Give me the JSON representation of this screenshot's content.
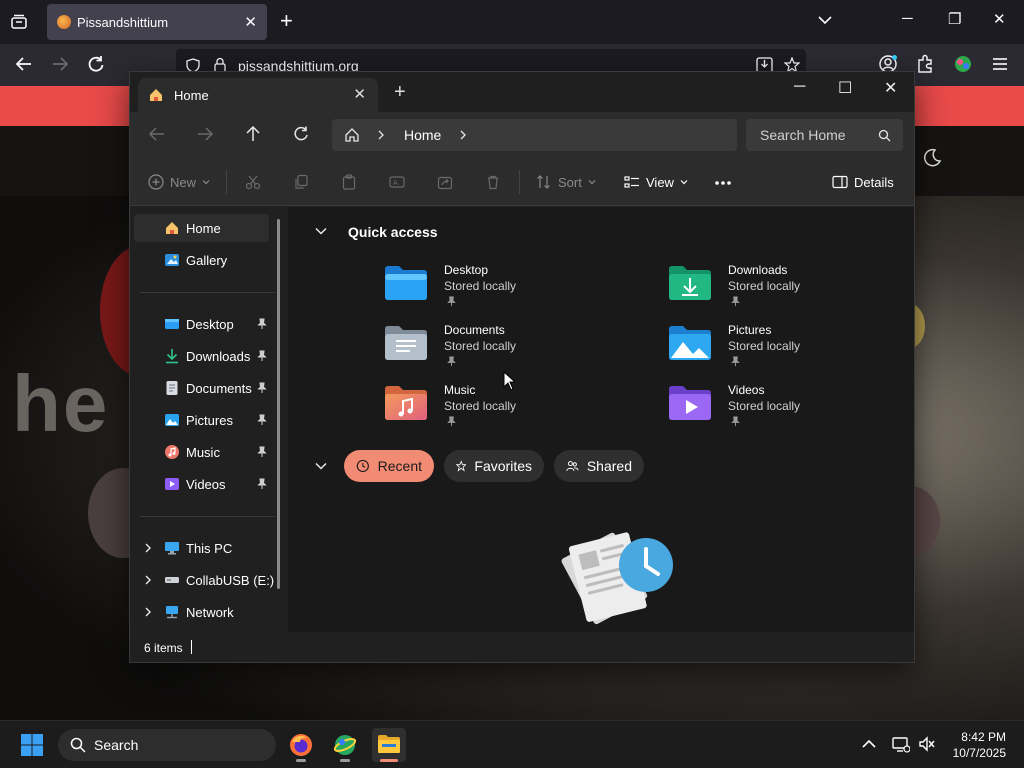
{
  "browser": {
    "tab_title": "Pissandshittium",
    "url": "pissandshittium.org",
    "page_bg_text": "he",
    "icons": [
      "tab-list-icon",
      "close-icon",
      "plus-icon",
      "chevron-down-icon",
      "minimize-icon",
      "maximize-icon",
      "close-icon",
      "back-icon",
      "forward-icon",
      "reload-icon",
      "shield-icon",
      "lock-icon",
      "download-icon",
      "star-icon",
      "account-icon",
      "extensions-icon",
      "menu-icon"
    ]
  },
  "explorer": {
    "tab_title": "Home",
    "breadcrumb": [
      "Home"
    ],
    "search_placeholder": "Search Home",
    "toolbar": {
      "new": "New",
      "sort": "Sort",
      "view": "View",
      "details": "Details"
    },
    "sidebar": {
      "top": [
        {
          "label": "Home",
          "icon": "home-icon",
          "selected": true
        },
        {
          "label": "Gallery",
          "icon": "gallery-icon"
        }
      ],
      "pinned": [
        {
          "label": "Desktop",
          "icon": "desktop-icon"
        },
        {
          "label": "Downloads",
          "icon": "downloads-icon"
        },
        {
          "label": "Documents",
          "icon": "documents-icon"
        },
        {
          "label": "Pictures",
          "icon": "pictures-icon"
        },
        {
          "label": "Music",
          "icon": "music-icon"
        },
        {
          "label": "Videos",
          "icon": "videos-icon"
        }
      ],
      "drives": [
        {
          "label": "This PC",
          "icon": "pc-icon"
        },
        {
          "label": "CollabUSB (E:)",
          "icon": "usb-drive-icon"
        },
        {
          "label": "Network",
          "icon": "network-icon"
        }
      ]
    },
    "quick_access": {
      "title": "Quick access",
      "items": [
        {
          "name": "Desktop",
          "status": "Stored locally",
          "icon": "desktop-folder-icon"
        },
        {
          "name": "Downloads",
          "status": "Stored locally",
          "icon": "downloads-folder-icon"
        },
        {
          "name": "Documents",
          "status": "Stored locally",
          "icon": "documents-folder-icon"
        },
        {
          "name": "Pictures",
          "status": "Stored locally",
          "icon": "pictures-folder-icon"
        },
        {
          "name": "Music",
          "status": "Stored locally",
          "icon": "music-folder-icon"
        },
        {
          "name": "Videos",
          "status": "Stored locally",
          "icon": "videos-folder-icon"
        }
      ]
    },
    "pills": {
      "recent": "Recent",
      "favorites": "Favorites",
      "shared": "Shared"
    },
    "status": {
      "item_count": "6 items"
    },
    "colors": {
      "accent": "#f28b73",
      "window_bg": "#202020",
      "content_bg": "#191919"
    }
  },
  "taskbar": {
    "search_placeholder": "Search",
    "time": "8:42 PM",
    "date": "10/7/2025",
    "apps": [
      "firefox-icon",
      "globe-app-icon",
      "file-explorer-icon"
    ]
  }
}
